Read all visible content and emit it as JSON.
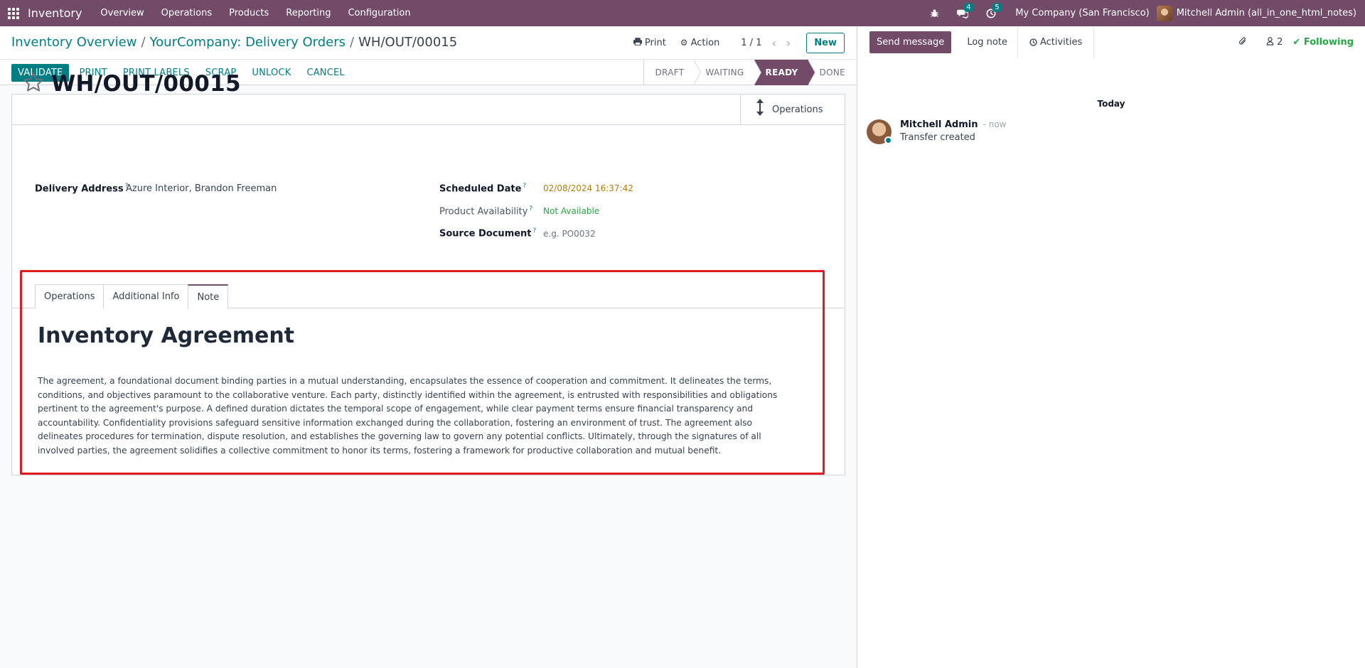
{
  "topbar": {
    "app_name": "Inventory",
    "menu": [
      "Overview",
      "Operations",
      "Products",
      "Reporting",
      "Configuration"
    ],
    "messages_count": "4",
    "activities_count": "5",
    "company": "My Company (San Francisco)",
    "user": "Mitchell Admin (all_in_one_html_notes)",
    "accent_color": "#714b67"
  },
  "breadcrumb": {
    "items": [
      "Inventory Overview",
      "YourCompany: Delivery Orders"
    ],
    "current": "WH/OUT/00015"
  },
  "control": {
    "print_label": "Print",
    "action_label": "Action",
    "pager": "1 / 1",
    "new_label": "New"
  },
  "statusbar": {
    "buttons": [
      "VALIDATE",
      "PRINT",
      "PRINT LABELS",
      "SCRAP",
      "UNLOCK",
      "CANCEL"
    ],
    "stages": [
      "DRAFT",
      "WAITING",
      "READY",
      "DONE"
    ],
    "active_stage": "READY"
  },
  "form": {
    "smart_button": "Operations",
    "title": "WH/OUT/00015",
    "delivery_address_label": "Delivery Address",
    "delivery_address": "Azure Interior, Brandon Freeman",
    "scheduled_date_label": "Scheduled Date",
    "scheduled_date": "02/08/2024 16:37:42",
    "availability_label": "Product Availability",
    "availability": "Not Available",
    "source_document_label": "Source Document",
    "source_document_placeholder": "e.g. PO0032",
    "help_mark": "?"
  },
  "notebook": {
    "tabs": [
      "Operations",
      "Additional Info",
      "Note"
    ],
    "active_tab": "Note",
    "note_title": "Inventory Agreement",
    "note_body": "The agreement, a foundational document binding parties in a mutual understanding, encapsulates the essence of cooperation and commitment. It delineates the terms, conditions, and objectives paramount to the collaborative venture. Each party, distinctly identified within the agreement, is entrusted with responsibilities and obligations pertinent to the agreement's purpose. A defined duration dictates the temporal scope of engagement, while clear payment terms ensure financial transparency and accountability. Confidentiality provisions safeguard sensitive information exchanged during the collaboration, fostering an environment of trust. The agreement also delineates procedures for termination, dispute resolution, and establishes the governing law to govern any potential conflicts. Ultimately, through the signatures of all involved parties, the agreement solidifies a collective commitment to honor its terms, fostering a framework for productive collaboration and mutual benefit."
  },
  "chatter": {
    "send_message": "Send message",
    "log_note": "Log note",
    "activities": "Activities",
    "followers_count": "2",
    "following": "Following",
    "date_separator": "Today",
    "messages": [
      {
        "author": "Mitchell Admin",
        "time": "- now",
        "text": "Transfer created"
      }
    ]
  }
}
